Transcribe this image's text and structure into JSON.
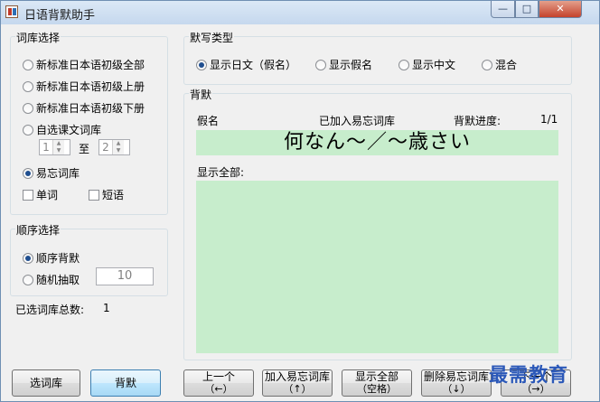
{
  "window": {
    "title": "日语背默助手"
  },
  "titlebar_buttons": {
    "minimize": "—",
    "maximize": "□",
    "close": "✕"
  },
  "library": {
    "title": "词库选择",
    "options": [
      {
        "label": "新标准日本语初级全部",
        "selected": false
      },
      {
        "label": "新标准日本语初级上册",
        "selected": false
      },
      {
        "label": "新标准日本语初级下册",
        "selected": false
      },
      {
        "label": "自选课文词库",
        "selected": false
      }
    ],
    "range_from": "1",
    "range_to_label": "至",
    "range_to": "2",
    "forget_option": {
      "label": "易忘词库",
      "selected": true
    },
    "check_word": "单词",
    "check_phrase": "短语"
  },
  "order": {
    "title": "顺序选择",
    "sequential": "顺序背默",
    "random": "随机抽取",
    "random_count": "10"
  },
  "total": {
    "label": "已选词库总数:",
    "value": "1"
  },
  "dictation": {
    "title": "默写类型",
    "options": [
      {
        "label": "显示日文（假名）",
        "selected": true
      },
      {
        "label": "显示假名",
        "selected": false
      },
      {
        "label": "显示中文",
        "selected": false
      },
      {
        "label": "混合",
        "selected": false
      }
    ]
  },
  "recite": {
    "title": "背默",
    "kana_label": "假名",
    "added_status": "已加入易忘词库",
    "progress_label": "背默进度:",
    "progress_value": "1/1",
    "current_word": "何なん～／～歳さい",
    "show_all_label": "显示全部:"
  },
  "buttons": {
    "select_library": "选词库",
    "recite": "背默",
    "prev": {
      "label": "上一个",
      "hint": "（←）"
    },
    "add_forget": {
      "label": "加入易忘词库",
      "hint": "（↑）"
    },
    "show_all": {
      "label": "显示全部",
      "hint": "（空格）"
    },
    "remove_forget": {
      "label": "删除易忘词库",
      "hint": "（↓）"
    },
    "next": {
      "label": "下一个",
      "hint": "（→）"
    }
  },
  "watermark": "最需教育",
  "colors": {
    "answer_bg": "#c7edcc",
    "focus_border": "#3c7fb1"
  }
}
